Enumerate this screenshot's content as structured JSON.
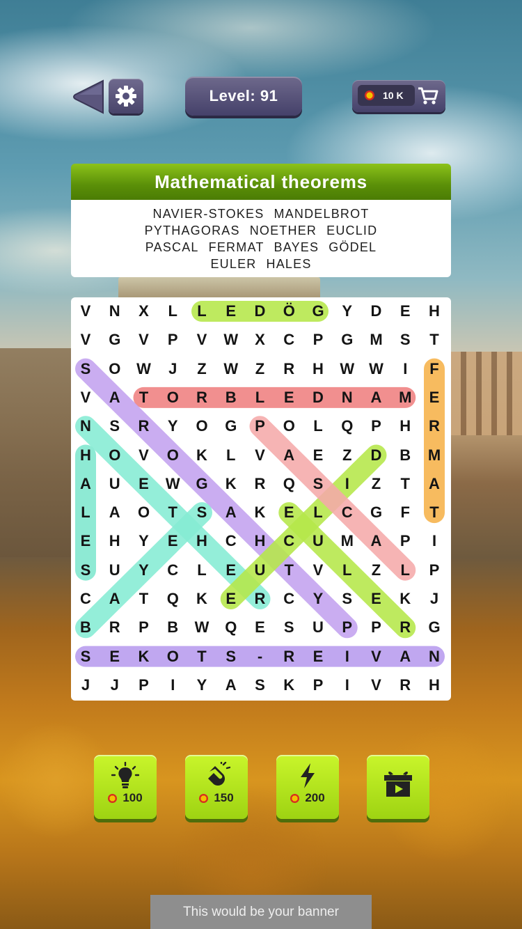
{
  "header": {
    "level_text": "Level: 91",
    "coins": "10 K",
    "icons": [
      "back-arrow-icon",
      "gear-icon",
      "coin-icon",
      "cart-icon"
    ]
  },
  "puzzle": {
    "topic": "Mathematical theorems",
    "words": [
      "NAVIER-STOKES",
      "MANDELBROT",
      "PYTHAGORAS",
      "NOETHER",
      "EUCLID",
      "PASCAL",
      "FERMAT",
      "BAYES",
      "GÖDEL",
      "EULER",
      "HALES"
    ]
  },
  "grid": {
    "rows": [
      "VNXLLEDÖGYDEH",
      "VGVPVWXCPGMST",
      "SOWJZWZRHWWIF",
      "VATORBLEDNAME",
      "NSRYOGPOLQPHR",
      "HOVOKLVAEZDBM",
      "AUEWGKRQSIZTA",
      "LAOTSAKELCGFT",
      "EHYEHCHCUMAPI",
      "SUYCLEUTVLZLP",
      "CATQKERCYSEKJ",
      "BRPBWQESUPPRG",
      "SEKOTS-REIVAN",
      "JJPIYASKPIVRH"
    ],
    "found": [
      {
        "word": "GÖDEL",
        "from": [
          0,
          8
        ],
        "to": [
          0,
          4
        ],
        "color": "#b6e84a"
      },
      {
        "word": "MANDELBROT",
        "from": [
          3,
          11
        ],
        "to": [
          3,
          2
        ],
        "color": "#f08080"
      },
      {
        "word": "FERMAT",
        "from": [
          2,
          12
        ],
        "to": [
          7,
          12
        ],
        "color": "#f6b24a"
      },
      {
        "word": "NAVIER-STOKES",
        "from": [
          12,
          12
        ],
        "to": [
          12,
          0
        ],
        "color": "#b89cef"
      },
      {
        "word": "PYTHAGORAS",
        "from": [
          11,
          9
        ],
        "to": [
          2,
          0
        ],
        "color": "#c3a2f0"
      },
      {
        "word": "HALES",
        "from": [
          5,
          0
        ],
        "to": [
          9,
          0
        ],
        "color": "#7fe8cf"
      },
      {
        "word": "NOETHER",
        "from": [
          4,
          0
        ],
        "to": [
          10,
          6
        ],
        "color": "#86ecd4"
      },
      {
        "word": "EUCLID",
        "from": [
          10,
          5
        ],
        "to": [
          5,
          10
        ],
        "color": "#b6e84a"
      },
      {
        "word": "PASCAL",
        "from": [
          4,
          6
        ],
        "to": [
          9,
          11
        ],
        "color": "#f5aaaa"
      },
      {
        "word": "EULER",
        "from": [
          7,
          7
        ],
        "to": [
          11,
          11
        ],
        "color": "#b6e84a"
      },
      {
        "word": "BAYES",
        "from": [
          11,
          0
        ],
        "to": [
          7,
          4
        ],
        "color": "#86ecd4"
      }
    ]
  },
  "boosters": [
    {
      "name": "hint",
      "icon": "lightbulb-icon",
      "price": "100"
    },
    {
      "name": "magnet",
      "icon": "magnet-icon",
      "price": "150"
    },
    {
      "name": "lightning",
      "icon": "lightning-icon",
      "price": "200"
    },
    {
      "name": "video",
      "icon": "gift-video-icon",
      "price": ""
    }
  ],
  "banner_text": "This would be your banner"
}
